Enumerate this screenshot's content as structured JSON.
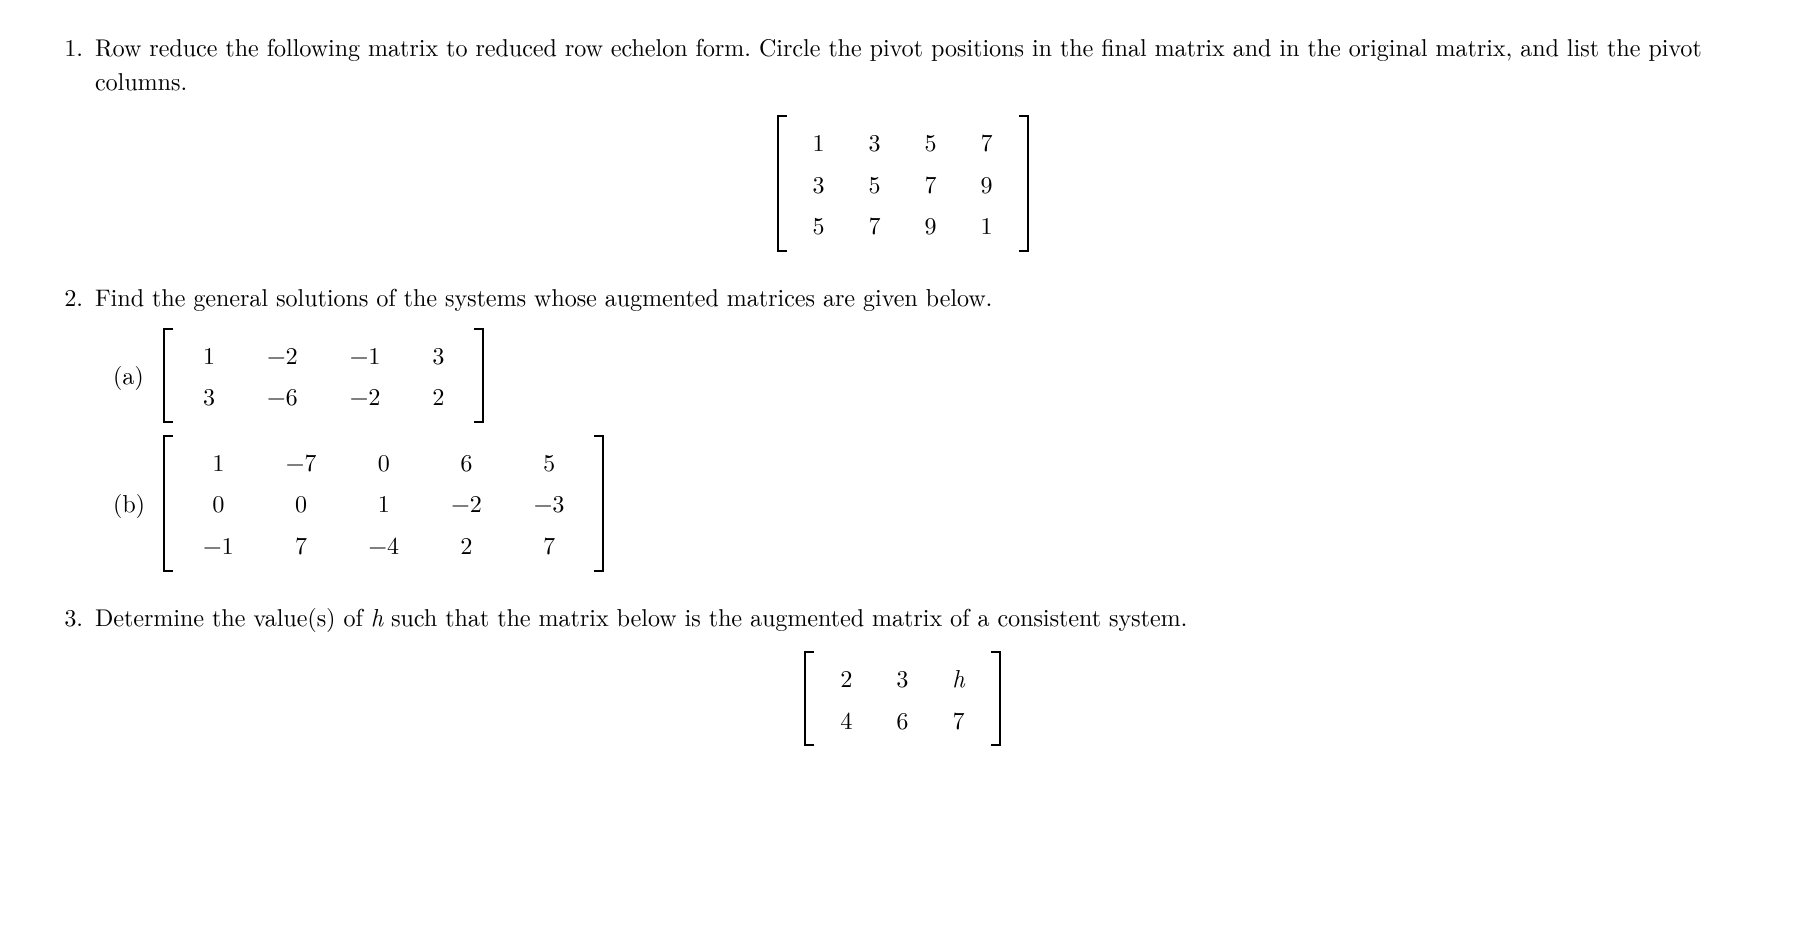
{
  "problems": [
    {
      "number": "1.",
      "text": "Row reduce the following matrix to reduced row echelon form. Circle the pivot positions in the final matrix and in the original matrix, and list the pivot columns.",
      "matrix": [
        [
          "1",
          "3",
          "5",
          "7"
        ],
        [
          "3",
          "5",
          "7",
          "9"
        ],
        [
          "5",
          "7",
          "9",
          "1"
        ]
      ]
    },
    {
      "number": "2.",
      "text": "Find the general solutions of the systems whose augmented matrices are given below.",
      "subparts": [
        {
          "label": "(a)",
          "matrix": [
            [
              "1",
              "−2",
              "−1",
              "3"
            ],
            [
              "3",
              "−6",
              "−2",
              "2"
            ]
          ]
        },
        {
          "label": "(b)",
          "matrix": [
            [
              "1",
              "−7",
              "0",
              "6",
              "5"
            ],
            [
              "0",
              "0",
              "1",
              "−2",
              "−3"
            ],
            [
              "−1",
              "7",
              "−4",
              "2",
              "7"
            ]
          ]
        }
      ]
    },
    {
      "number": "3.",
      "text_pre": "Determine the value(s) of ",
      "text_var": "h",
      "text_post": " such that the matrix below is the augmented matrix of a consistent system.",
      "matrix": [
        [
          "2",
          "3",
          "h"
        ],
        [
          "4",
          "6",
          "7"
        ]
      ]
    }
  ]
}
